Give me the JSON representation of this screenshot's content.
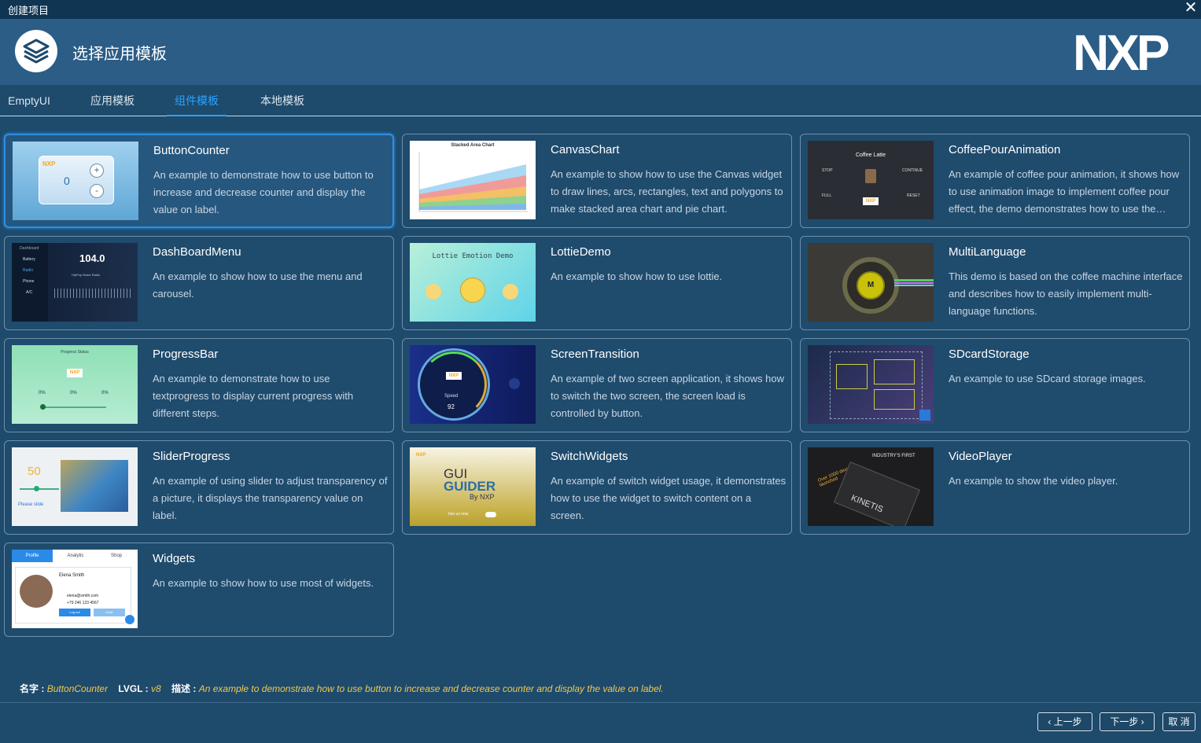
{
  "window": {
    "title": "创建项目",
    "close_glyph": "✕"
  },
  "header": {
    "title": "选择应用模板",
    "brand": "NXP",
    "logo_icon": "layers-icon"
  },
  "tabs": [
    {
      "label": "EmptyUI"
    },
    {
      "label": "应用模板"
    },
    {
      "label": "组件模板",
      "active": true
    },
    {
      "label": "本地模板"
    }
  ],
  "templates": [
    {
      "name": "ButtonCounter",
      "desc": "An example to demonstrate how to use button to increase and decrease counter and display the value on label.",
      "selected": true,
      "thumb": {
        "value": "0",
        "plus": "+",
        "minus": "-"
      }
    },
    {
      "name": "CanvasChart",
      "desc": "An example to show how to use the Canvas widget to draw lines, arcs, rectangles, text and polygons to make stacked area chart and pie chart.",
      "thumb": {
        "title": "Stacked Area Chart"
      }
    },
    {
      "name": "CoffeePourAnimation",
      "desc": "An example of coffee pour animation, it shows how to use animation image to implement coffee pour effect, the demo demonstrates how to use the animation image.",
      "thumb": {
        "title": "Coffee Latte",
        "stop": "STOP",
        "continue": "CONTINUE",
        "full": "FULL",
        "reset": "RESET"
      }
    },
    {
      "name": "DashBoardMenu",
      "desc": "An example to show how to use the menu and carousel.",
      "thumb": {
        "menu": [
          "Dashboard",
          "Battery",
          "Radio",
          "Phone",
          "A/C"
        ],
        "freq": "104.0",
        "station": "HipPop Music Radio"
      }
    },
    {
      "name": "LottieDemo",
      "desc": "An example to show how to use lottie.",
      "thumb": {
        "title": "Lottie Emotion Demo"
      }
    },
    {
      "name": "MultiLanguage",
      "desc": "This demo is based on the coffee machine interface and describes how to easily implement multi-language functions.",
      "thumb": {
        "center": "M"
      }
    },
    {
      "name": "ProgressBar",
      "desc": "An example to demonstrate how to use textprogress to display current progress with different steps.",
      "thumb": {
        "title": "Progress Status",
        "percents": [
          "0%",
          "0%",
          "0%"
        ]
      }
    },
    {
      "name": "ScreenTransition",
      "desc": "An example of two screen application, it shows how to switch the two screen, the screen load is controlled by button.",
      "thumb": {
        "speed": "92",
        "label": "Speed"
      }
    },
    {
      "name": "SDcardStorage",
      "desc": "An example to use SDcard storage images.",
      "thumb": {}
    },
    {
      "name": "SliderProgress",
      "desc": "An example of using slider to adjust transparency of a picture, it displays the transparency value on label.",
      "thumb": {
        "value": "50",
        "hint": "Please slide"
      }
    },
    {
      "name": "SwitchWidgets",
      "desc": "An example of switch widget usage, it demonstrates how to use the widget to switch content on a screen.",
      "thumb": {
        "line1": "GUI",
        "line2": "GUIDER",
        "line3": "By NXP",
        "join": "Join us now"
      }
    },
    {
      "name": "VideoPlayer",
      "desc": "An example to show the video player.",
      "thumb": {
        "chip": "KINETIS",
        "headline": "INDUSTRY'S FIRST",
        "banner": "Over 1000 devices launched"
      }
    },
    {
      "name": "Widgets",
      "desc": "An example to show how to use most of widgets.",
      "thumb": {
        "tabs": [
          "Profile",
          "Analytic",
          "Shop"
        ],
        "person": "Elena Smith",
        "email": "elena@smith.com",
        "phone": "+79 246 123 4567",
        "btn1": "Log out",
        "btn2": "Invite"
      }
    }
  ],
  "info": {
    "name_label": "名字 :",
    "name_value": "ButtonCounter",
    "lvgl_label": "LVGL :",
    "lvgl_value": "v8",
    "desc_label": "描述 :",
    "desc_value": "An example to demonstrate how to use button to increase and decrease counter and display the value on label."
  },
  "buttons": {
    "prev": "‹  上一步",
    "next": "下一步 ›",
    "cancel": "取 消"
  }
}
